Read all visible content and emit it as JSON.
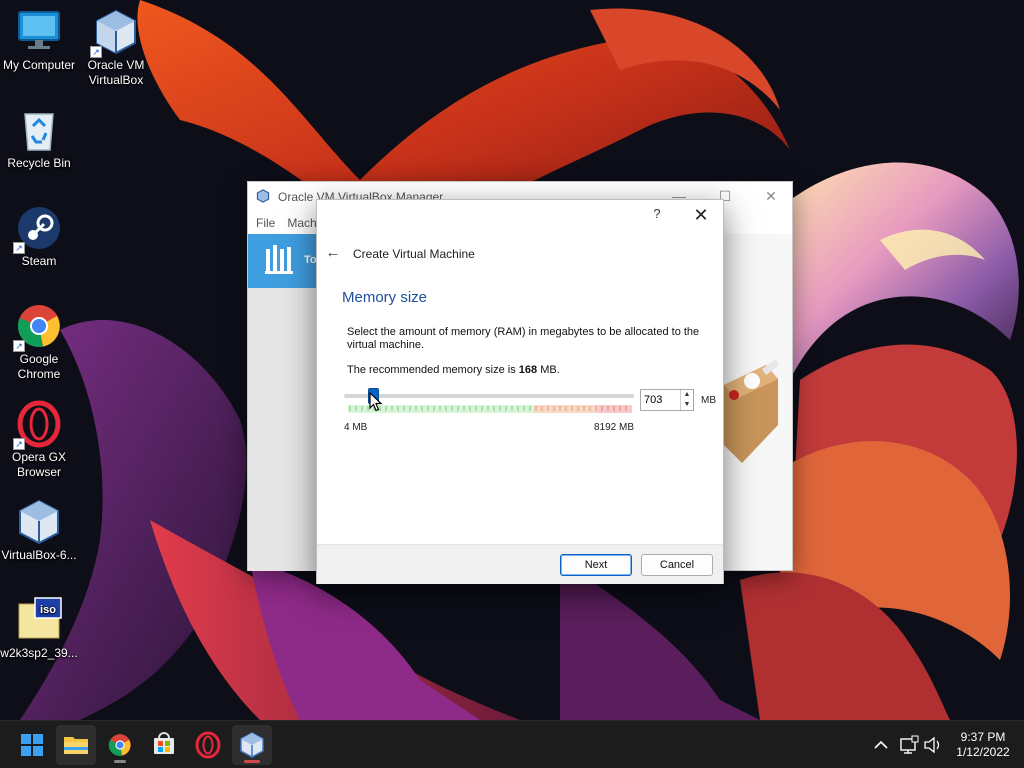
{
  "desktop": {
    "icons": [
      {
        "label": "My Computer",
        "icon": "computer-icon"
      },
      {
        "label": "Oracle VM VirtualBox",
        "icon": "virtualbox-icon"
      },
      {
        "label": "Recycle Bin",
        "icon": "recycle-bin-icon"
      },
      {
        "label": "Steam",
        "icon": "steam-icon"
      },
      {
        "label": "Google Chrome",
        "icon": "chrome-icon"
      },
      {
        "label": "Opera GX Browser",
        "icon": "opera-icon"
      },
      {
        "label": "VirtualBox-6...",
        "icon": "virtualbox-installer-icon"
      },
      {
        "label": "w2k3sp2_39...",
        "icon": "iso-file-icon"
      }
    ]
  },
  "manager": {
    "title": "Oracle VM VirtualBox Manager",
    "menu": [
      "File",
      "Mach"
    ],
    "tools_label": "To"
  },
  "dialog": {
    "help": "?",
    "close": "✕",
    "back": "←",
    "wizard_title": "Create Virtual Machine",
    "page_title": "Memory size",
    "description": "Select the amount of memory (RAM) in megabytes to be allocated to the virtual machine.",
    "recommended_prefix": "The recommended memory size is ",
    "recommended_value": "168",
    "recommended_suffix": " MB.",
    "memory": {
      "value": "703",
      "min": 4,
      "max": 8192,
      "unit": "MB"
    },
    "min_label": "4 MB",
    "max_label": "8192 MB",
    "next_label": "Next",
    "cancel_label": "Cancel"
  },
  "taskbar": {
    "apps": [
      "start-icon",
      "file-explorer-icon",
      "chrome-icon",
      "store-icon",
      "opera-icon",
      "virtualbox-icon"
    ],
    "clock_time": "9:37 PM",
    "clock_date": "1/12/2022"
  },
  "colors": {
    "accent": "#0a64c8",
    "page_title": "#1f4e9a",
    "scale_green": "#8ed68e",
    "scale_orange": "#f2b38c",
    "scale_red": "#f19a9a"
  }
}
